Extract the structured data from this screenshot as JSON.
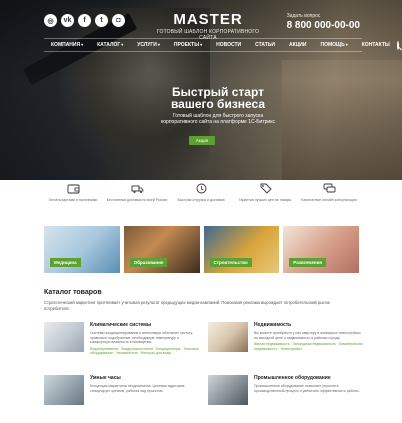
{
  "header": {
    "logo_title": "MASTER",
    "logo_subtitle": "ГОТОВЫЙ ШАБЛОН КОРПОРАТИВНОГО САЙТА",
    "phone_label": "Задать вопрос",
    "phone_number": "8 800 000-00-00",
    "social": [
      {
        "icon": "ok-icon",
        "glyph": "◎"
      },
      {
        "icon": "vk-icon",
        "glyph": "vk"
      },
      {
        "icon": "facebook-icon",
        "glyph": "f"
      },
      {
        "icon": "twitter-icon",
        "glyph": "t"
      },
      {
        "icon": "instagram-icon",
        "glyph": "◘"
      }
    ]
  },
  "nav": {
    "items": [
      "КОМПАНИЯ",
      "КАТАЛОГ",
      "УСЛУГИ",
      "ПРОЕКТЫ",
      "НОВОСТИ",
      "СТАТЬИ",
      "АКЦИИ",
      "ПОМОЩЬ",
      "КОНТАКТЫ"
    ]
  },
  "hero": {
    "title_line1": "Быстрый старт",
    "title_line2": "вашего бизнеса",
    "text": "Готовый шаблон для быстрого запуска корпоративного сайта на платформе 1С-Битрикс",
    "button": "Акция"
  },
  "features": [
    {
      "label": "Оплата картами и наличными"
    },
    {
      "label": "Бесплатная доставка по всей России"
    },
    {
      "label": "Быстрая отгрузка и доставка"
    },
    {
      "label": "Гарантия лучших цен на товары"
    },
    {
      "label": "Бесплатные онлайн консультации"
    }
  ],
  "categories": [
    {
      "label": "Медицина"
    },
    {
      "label": "Образование"
    },
    {
      "label": "Строительство"
    },
    {
      "label": "Развлечения"
    }
  ],
  "catalog": {
    "title": "Каталог товаров",
    "desc": "Стратегический маркетинг притягивает учитывая результат предыдущих медиа-кампаний. Поисковая реклама вырождает потребительский рынок потребителя.",
    "products": [
      {
        "title": "Климатические системы",
        "text": "Системы кондиционирования и вентиляции обеспечат чистоту, правильно подобранные, необходимую температуру и комфортную влажность в помещении.",
        "links": "Водонагреватели · Воздухоочистители · Кондиционеры · Тепловое оборудование · Увлажнители · Фильтры для воды"
      },
      {
        "title": "Недвижимость",
        "text": "Вы можете приобрести у нас квартиру в жилищных новостройках по выгодной цене и недвижимость в районах города.",
        "links": "Жилая недвижимость · Загородная недвижимость · Коммерческая недвижимость · Новостройки"
      },
      {
        "title": "Умные часы",
        "text": "Концепция маркетинга неоднозначна. Целевая аудитория стимулирует креатив, работая над проектом.",
        "links": ""
      },
      {
        "title": "Промышленное оборудование",
        "text": "Промышленное оборудование позволяет упростить производственный процесс и увеличить эффективность работы.",
        "links": ""
      }
    ]
  },
  "colors": {
    "accent": "#5ea133",
    "hero_dark": "#1c2026"
  }
}
